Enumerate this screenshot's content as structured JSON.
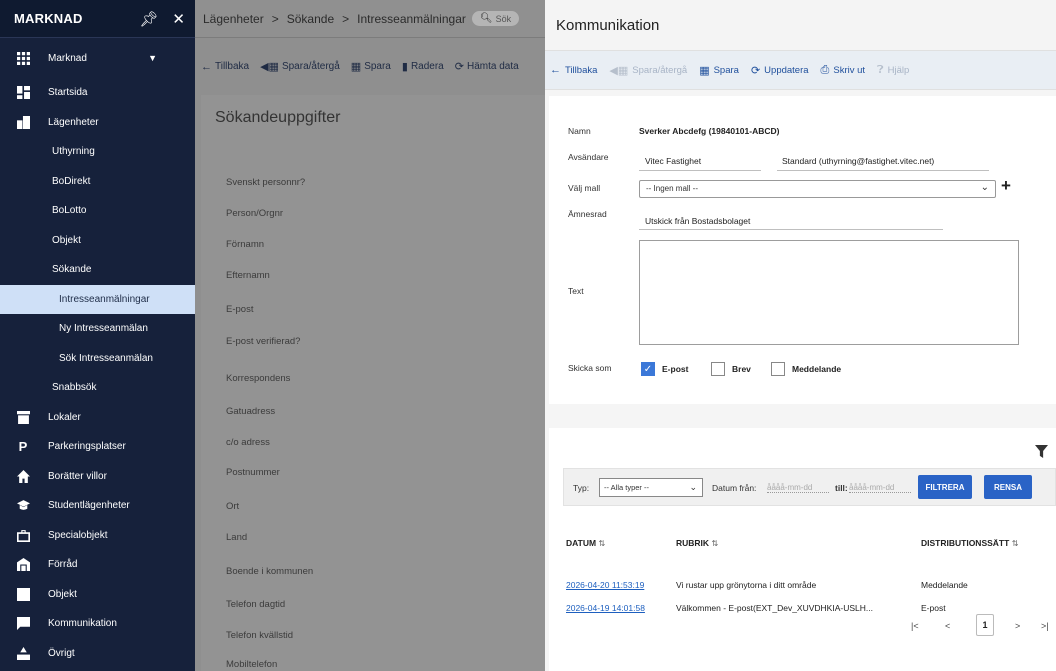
{
  "sidebar": {
    "title": "MARKNAD",
    "top_select": "Marknad",
    "items": [
      {
        "label": "Startsida",
        "icon": "dashboard-icon"
      },
      {
        "label": "Lägenheter",
        "icon": "building-icon"
      },
      {
        "label": "Uthyrning"
      },
      {
        "label": "BoDirekt"
      },
      {
        "label": "BoLotto"
      },
      {
        "label": "Objekt"
      },
      {
        "label": "Sökande"
      },
      {
        "label": "Intresseanmälningar"
      },
      {
        "label": "Ny Intresseanmälan"
      },
      {
        "label": "Sök Intresseanmälan"
      },
      {
        "label": "Snabbsök"
      },
      {
        "label": "Lokaler",
        "icon": "store-icon"
      },
      {
        "label": "Parkeringsplatser",
        "icon": "parking-icon"
      },
      {
        "label": "Borätter villor",
        "icon": "home-icon"
      },
      {
        "label": "Studentlägenheter",
        "icon": "graduation-cap-icon"
      },
      {
        "label": "Specialobjekt",
        "icon": "briefcase-icon"
      },
      {
        "label": "Förråd",
        "icon": "storage-icon"
      },
      {
        "label": "Objekt",
        "icon": "object-icon"
      },
      {
        "label": "Kommunikation",
        "icon": "chat-icon"
      },
      {
        "label": "Övrigt",
        "icon": "misc-icon"
      }
    ]
  },
  "left": {
    "breadcrumb": [
      "Lägenheter",
      "Sökande",
      "Intresseanmälningar"
    ],
    "search_placeholder": "Sök",
    "toolbar": [
      "Tillbaka",
      "Spara/återgå",
      "Spara",
      "Radera",
      "Hämta data"
    ],
    "card_title": "Sökandeuppgifter",
    "fields": [
      "Svenskt personnr?",
      "Person/Orgnr",
      "Förnamn",
      "Efternamn",
      "E-post",
      "E-post verifierad?",
      "Korrespondens",
      "Gatuadress",
      "c/o adress",
      "Postnummer",
      "Ort",
      "Land",
      "Boende i kommunen",
      "Telefon dagtid",
      "Telefon kvällstid",
      "Mobiltelefon"
    ]
  },
  "dialog": {
    "title": "Kommunikation",
    "toolbar": {
      "back": "Tillbaka",
      "save_return": "Spara/återgå",
      "save": "Spara",
      "update": "Uppdatera",
      "print": "Skriv ut",
      "help": "Hjälp"
    },
    "form": {
      "name_label": "Namn",
      "name_value": "Sverker Abcdefg (19840101-ABCD)",
      "sender_label": "Avsändare",
      "sender_value": "Vitec Fastighet",
      "sender_email": "Standard (uthyrning@fastighet.vitec.net)",
      "template_label": "Välj mall",
      "template_value": "-- Ingen mall --",
      "subject_label": "Ämnesrad",
      "subject_value": "Utskick från Bostadsbolaget",
      "text_label": "Text",
      "send_as_label": "Skicka som",
      "send_options": [
        {
          "label": "E-post",
          "checked": true
        },
        {
          "label": "Brev",
          "checked": false
        },
        {
          "label": "Meddelande",
          "checked": false
        }
      ]
    },
    "history": {
      "type_label": "Typ:",
      "type_value": "-- Alla typer --",
      "date_from_label": "Datum från:",
      "date_to_label": "till:",
      "date_placeholder": "åååå-mm-dd",
      "filter_button": "FILTRERA",
      "clear_button": "RENSA",
      "columns": [
        "DATUM",
        "RUBRIK",
        "DISTRIBUTIONSSÄTT"
      ],
      "rows": [
        {
          "date": "2026-04-20 11:53:19",
          "subject": "Vi rustar upp grönytorna i ditt område",
          "method": "Meddelande"
        },
        {
          "date": "2026-04-19 14:01:58",
          "subject": "Välkommen - E-post(EXT_Dev_XUVDHKIA-USLH...",
          "method": "E-post"
        }
      ],
      "current_page": "1"
    }
  }
}
